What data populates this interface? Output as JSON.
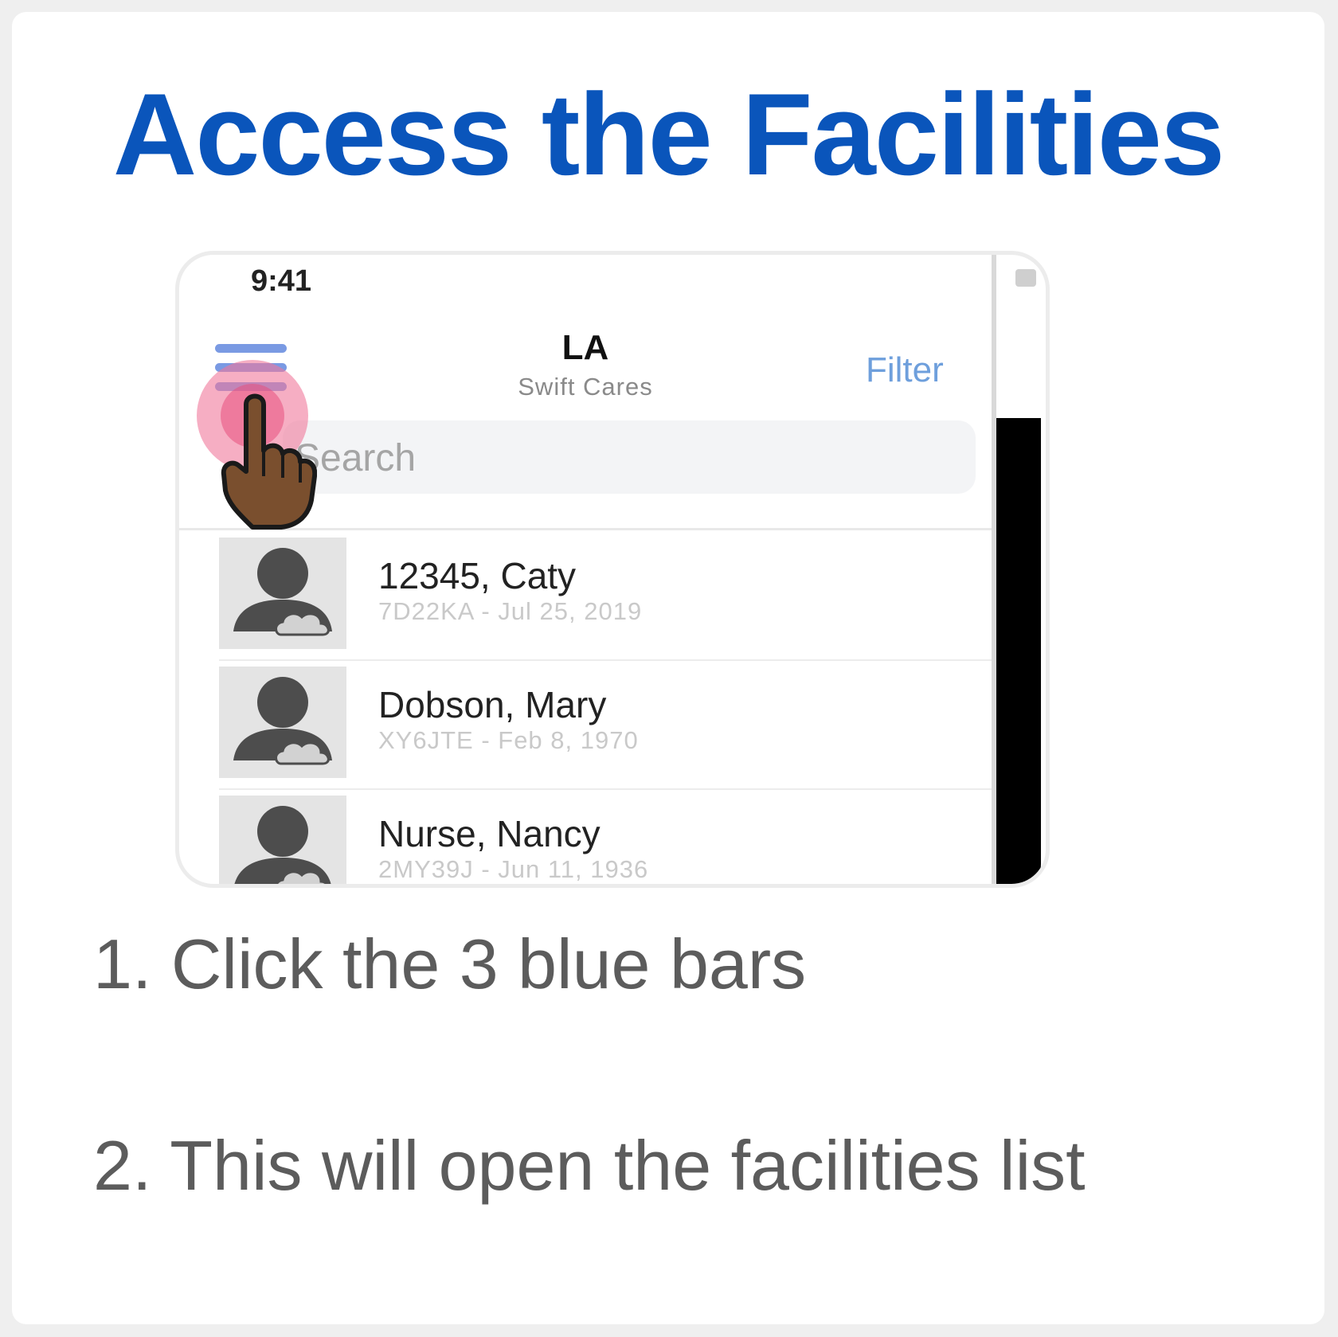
{
  "title": "Access the Facilities",
  "phone": {
    "status_time": "9:41",
    "nav_title": "LA",
    "nav_subtitle": "Swift Cares",
    "filter_label": "Filter",
    "search_placeholder": "Search",
    "patients": [
      {
        "name": "12345, Caty",
        "detail": "7D22KA - Jul 25, 2019"
      },
      {
        "name": "Dobson, Mary",
        "detail": "XY6JTE - Feb 8, 1970"
      },
      {
        "name": "Nurse, Nancy",
        "detail": "2MY39J - Jun 11, 1936"
      }
    ],
    "colors": {
      "accent": "#6e9fdc",
      "hamburger": "#6b8fe0",
      "tap_highlight": "#f0789b"
    }
  },
  "steps": [
    "1. Click the 3 blue bars",
    "2. This will open the facilities list"
  ],
  "colors": {
    "title": "#0a55bb",
    "step_text": "#5c5c5c"
  }
}
